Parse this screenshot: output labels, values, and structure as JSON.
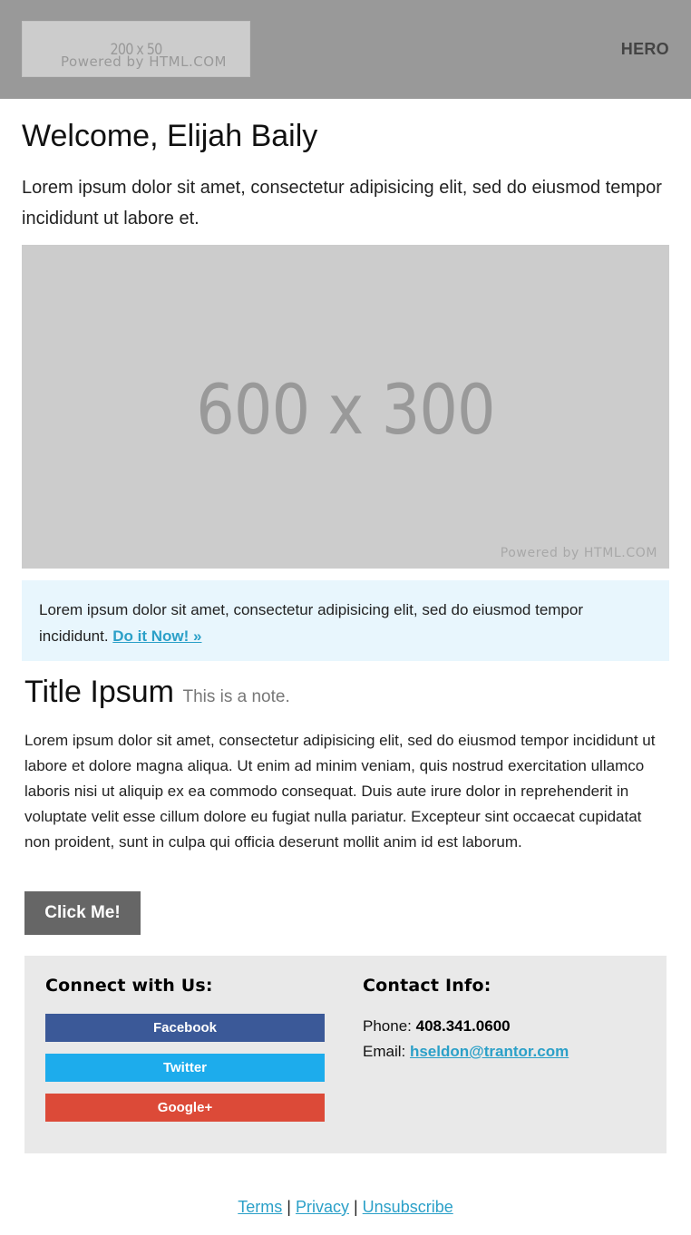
{
  "header": {
    "logo": {
      "dimensions": "200 x 50",
      "powered_by": "Powered by HTML.COM"
    },
    "label": "HERO",
    "background_color": "#999999"
  },
  "welcome": {
    "title": "Welcome, Elijah Baily",
    "intro": "Lorem ipsum dolor sit amet, consectetur adipisicing elit, sed do eiusmod tempor incididunt ut labore et."
  },
  "hero_image": {
    "dimensions": "600 x 300",
    "powered_by": "Powered by HTML.COM"
  },
  "callout": {
    "text": "Lorem ipsum dolor sit amet, consectetur adipisicing elit, sed do eiusmod tempor incididunt. ",
    "link_label": "Do it Now! »",
    "background_color": "#e8f6fd",
    "link_color": "#2ba0c8"
  },
  "article": {
    "title": "Title Ipsum",
    "note": "This is a note.",
    "body": "Lorem ipsum dolor sit amet, consectetur adipisicing elit, sed do eiusmod tempor incididunt ut labore et dolore magna aliqua. Ut enim ad minim veniam, quis nostrud exercitation ullamco laboris nisi ut aliquip ex ea commodo consequat. Duis aute irure dolor in reprehenderit in voluptate velit esse cillum dolore eu fugiat nulla pariatur. Excepteur sint occaecat cupidatat non proident, sunt in culpa qui officia deserunt mollit anim id est laborum.",
    "button_label": "Click Me!"
  },
  "footer_box": {
    "connect": {
      "title": "Connect with Us:",
      "buttons": [
        {
          "label": "Facebook",
          "color": "#3b5998"
        },
        {
          "label": "Twitter",
          "color": "#1dacec"
        },
        {
          "label": "Google+",
          "color": "#dc4a38"
        }
      ]
    },
    "contact": {
      "title": "Contact Info:",
      "phone_label": "Phone: ",
      "phone": "408.341.0600",
      "email_label": "Email: ",
      "email": "hseldon@trantor.com"
    }
  },
  "footer_links": {
    "items": [
      "Terms",
      "Privacy",
      "Unsubscribe"
    ],
    "separator": " | "
  }
}
